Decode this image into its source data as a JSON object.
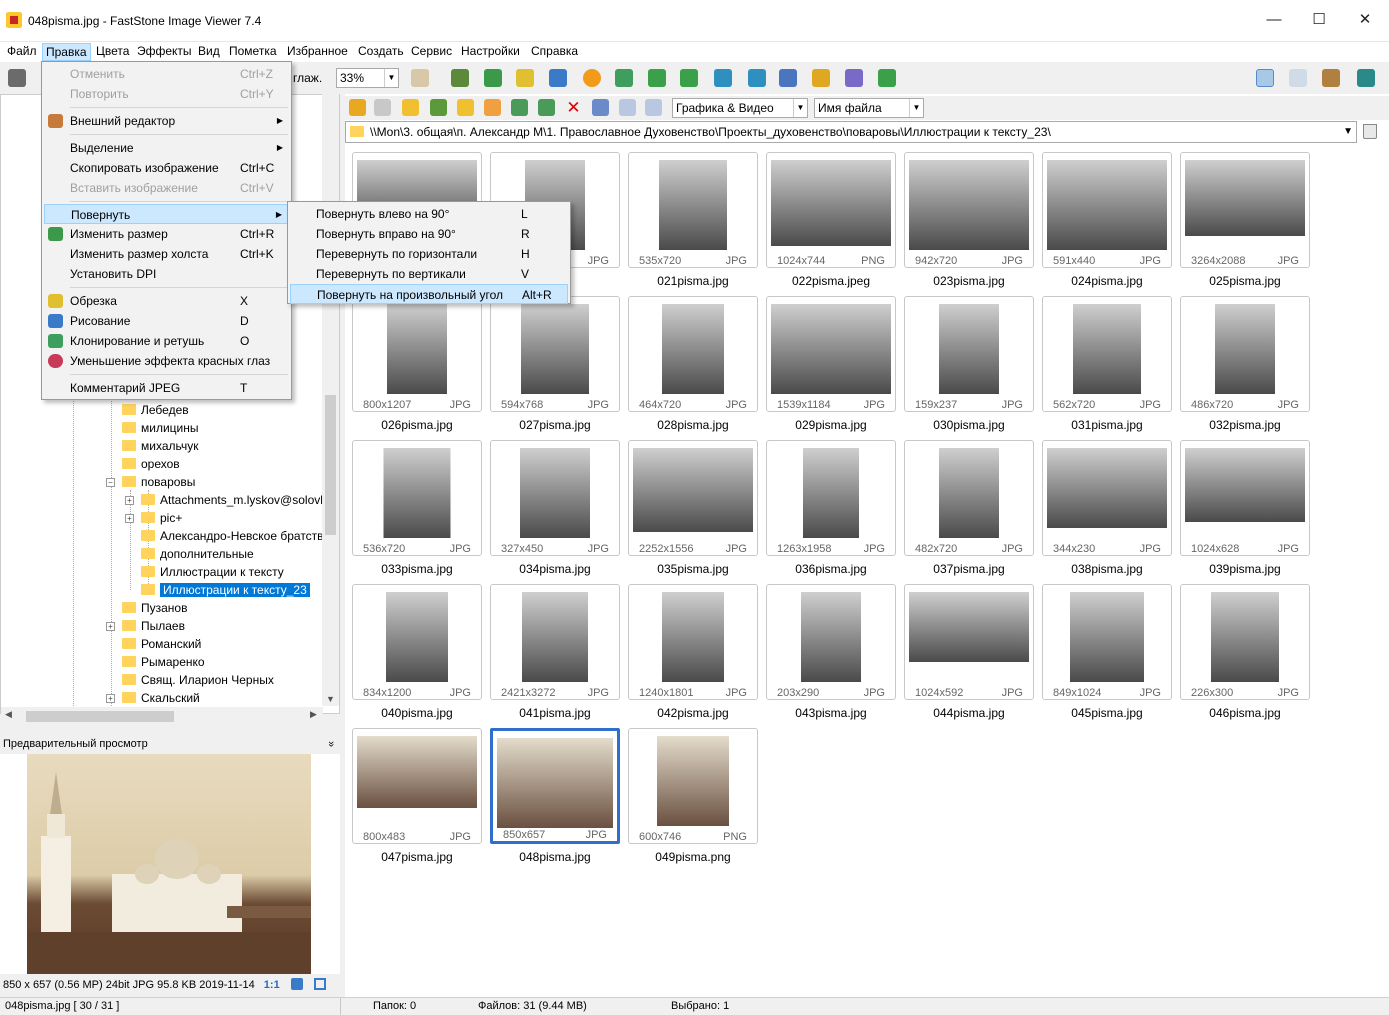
{
  "window": {
    "title": "048pisma.jpg  -  FastStone Image Viewer 7.4",
    "minimize": "—",
    "maximize": "☐",
    "close": "✕"
  },
  "menubar": [
    "Файл",
    "Правка",
    "Цвета",
    "Эффекты",
    "Вид",
    "Пометка",
    "Избранное",
    "Создать",
    "Сервис",
    "Настройки",
    "Справка"
  ],
  "toolbar": {
    "smooth_label": "глаж.",
    "zoom": "33%"
  },
  "edit_menu": [
    {
      "label": "Отменить",
      "shortcut": "Ctrl+Z",
      "disabled": true
    },
    {
      "label": "Повторить",
      "shortcut": "Ctrl+Y",
      "disabled": true
    },
    {
      "label": "Внешний редактор",
      "arrow": "▶"
    },
    {
      "label": "Выделение",
      "arrow": "▶"
    },
    {
      "label": "Скопировать изображение",
      "shortcut": "Ctrl+C"
    },
    {
      "label": "Вставить изображение",
      "shortcut": "Ctrl+V",
      "disabled": true
    },
    {
      "label": "Повернуть",
      "arrow": "▶"
    },
    {
      "label": "Изменить размер",
      "shortcut": "Ctrl+R"
    },
    {
      "label": "Изменить размер холста",
      "shortcut": "Ctrl+K"
    },
    {
      "label": "Установить DPI"
    },
    {
      "label": "Обрезка",
      "shortcut": "X"
    },
    {
      "label": "Рисование",
      "shortcut": "D"
    },
    {
      "label": "Клонирование и ретушь",
      "shortcut": "O"
    },
    {
      "label": "Уменьшение эффекта красных глаз"
    },
    {
      "label": "Комментарий JPEG",
      "shortcut": "T"
    }
  ],
  "rotate_menu": [
    {
      "label": "Повернуть влево на 90°",
      "shortcut": "L"
    },
    {
      "label": "Повернуть вправо на 90°",
      "shortcut": "R"
    },
    {
      "label": "Перевернуть по горизонтали",
      "shortcut": "H"
    },
    {
      "label": "Перевернуть по вертикали",
      "shortcut": "V"
    },
    {
      "label": "Повернуть на произвольный угол",
      "shortcut": "Alt+R"
    }
  ],
  "tree": {
    "items": [
      "Лебедев",
      "милицины",
      "михальчук",
      "орехов",
      "поваровы",
      "Attachments_m.lyskov@solovk",
      "pic+",
      "Александро-Невское братств",
      "дополнительные",
      "Иллюстрации к тексту",
      "Иллюстрации к тексту_23",
      "Пузанов",
      "Пылаев",
      "Романский",
      "Рымаренко",
      "Свящ. Иларион Черных",
      "Скальский"
    ],
    "expanders": [
      "−",
      "+",
      "+",
      "+",
      "+"
    ]
  },
  "preview": {
    "header": "Предварительный просмотр",
    "collapse": "»",
    "info": "850 x 657 (0.56 MP)   24bit   JPG   95.8 KB   2019-11-14",
    "ratio": "1:1"
  },
  "nav": {
    "filter": "Графика & Видео",
    "sort": "Имя файла"
  },
  "path": "\\\\Mon\\3. общая\\п. Александр М\\1. Православное Духовенство\\Проекты_духовенство\\поваровы\\Иллюстрации к тексту_23\\",
  "thumbnails": [
    {
      "name": "",
      "dims": "",
      "type": ""
    },
    {
      "name": "",
      "dims": "",
      "type": "JPG"
    },
    {
      "name": "021pisma.jpg",
      "dims": "535x720",
      "type": "JPG"
    },
    {
      "name": "022pisma.jpeg",
      "dims": "1024x744",
      "type": "PNG"
    },
    {
      "name": "023pisma.jpg",
      "dims": "942x720",
      "type": "JPG"
    },
    {
      "name": "024pisma.jpg",
      "dims": "591x440",
      "type": "JPG"
    },
    {
      "name": "025pisma.jpg",
      "dims": "3264x2088",
      "type": "JPG"
    },
    {
      "name": "026pisma.jpg",
      "dims": "800x1207",
      "type": "JPG"
    },
    {
      "name": "027pisma.jpg",
      "dims": "594x768",
      "type": "JPG"
    },
    {
      "name": "028pisma.jpg",
      "dims": "464x720",
      "type": "JPG"
    },
    {
      "name": "029pisma.jpg",
      "dims": "1539x1184",
      "type": "JPG"
    },
    {
      "name": "030pisma.jpg",
      "dims": "159x237",
      "type": "JPG"
    },
    {
      "name": "031pisma.jpg",
      "dims": "562x720",
      "type": "JPG"
    },
    {
      "name": "032pisma.jpg",
      "dims": "486x720",
      "type": "JPG"
    },
    {
      "name": "033pisma.jpg",
      "dims": "536x720",
      "type": "JPG"
    },
    {
      "name": "034pisma.jpg",
      "dims": "327x450",
      "type": "JPG"
    },
    {
      "name": "035pisma.jpg",
      "dims": "2252x1556",
      "type": "JPG"
    },
    {
      "name": "036pisma.jpg",
      "dims": "1263x1958",
      "type": "JPG"
    },
    {
      "name": "037pisma.jpg",
      "dims": "482x720",
      "type": "JPG"
    },
    {
      "name": "038pisma.jpg",
      "dims": "344x230",
      "type": "JPG"
    },
    {
      "name": "039pisma.jpg",
      "dims": "1024x628",
      "type": "JPG"
    },
    {
      "name": "040pisma.jpg",
      "dims": "834x1200",
      "type": "JPG"
    },
    {
      "name": "041pisma.jpg",
      "dims": "2421x3272",
      "type": "JPG"
    },
    {
      "name": "042pisma.jpg",
      "dims": "1240x1801",
      "type": "JPG"
    },
    {
      "name": "043pisma.jpg",
      "dims": "203x290",
      "type": "JPG"
    },
    {
      "name": "044pisma.jpg",
      "dims": "1024x592",
      "type": "JPG"
    },
    {
      "name": "045pisma.jpg",
      "dims": "849x1024",
      "type": "JPG"
    },
    {
      "name": "046pisma.jpg",
      "dims": "226x300",
      "type": "JPG"
    },
    {
      "name": "047pisma.jpg",
      "dims": "800x483",
      "type": "JPG"
    },
    {
      "name": "048pisma.jpg",
      "dims": "850x657",
      "type": "JPG",
      "selected": true
    },
    {
      "name": "049pisma.png",
      "dims": "600x746",
      "type": "PNG"
    }
  ],
  "status": {
    "file": "048pisma.jpg [ 30 / 31 ]",
    "folders": "Папок: 0",
    "files": "Файлов: 31 (9.44 MB)",
    "selected": "Выбрано: 1"
  },
  "colors": {
    "accent": "#0078d7",
    "selection_border": "#2f6fcc",
    "menu_highlight": "#cce8ff",
    "folder": "#ffd35c"
  },
  "icons": [
    "camera-icon",
    "hand-icon",
    "back-arrow-icon",
    "forward-arrow-icon",
    "folder-up-icon",
    "close-icon",
    "trash-icon",
    "folder-icon"
  ]
}
